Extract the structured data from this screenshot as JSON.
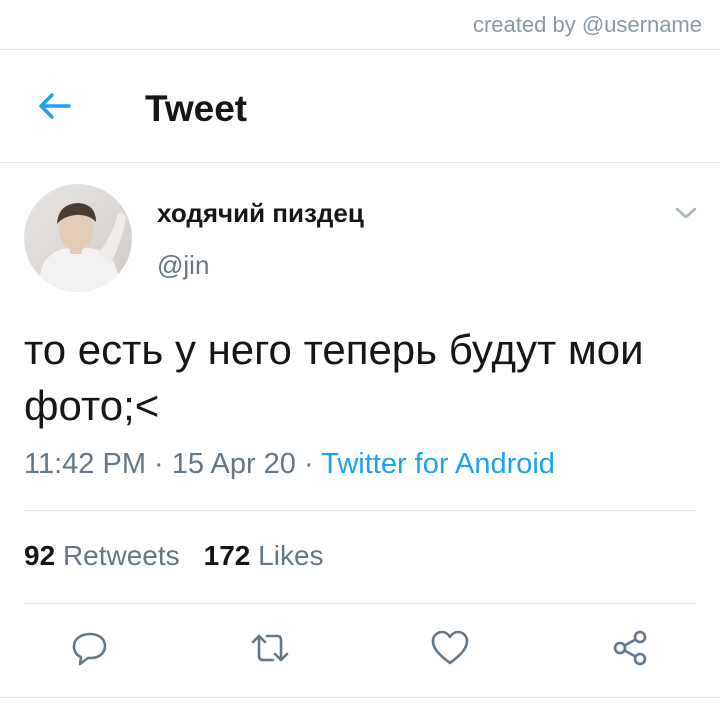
{
  "watermark": "created by @username",
  "header": {
    "title": "Tweet"
  },
  "tweet": {
    "display_name": "ходячий пиздец",
    "handle": "@jin",
    "text": "то есть у него теперь будут мои фото;<",
    "time": "11:42 PM",
    "date": "15 Apr 20",
    "separator": "·",
    "source": "Twitter for Android"
  },
  "stats": {
    "retweets_count": "92",
    "retweets_label": "Retweets",
    "likes_count": "172",
    "likes_label": "Likes"
  },
  "icons": {
    "back": "arrow-left-icon",
    "caret": "chevron-down-icon",
    "reply": "reply-icon",
    "retweet": "retweet-icon",
    "like": "heart-icon",
    "share": "share-icon"
  },
  "colors": {
    "accent": "#1da1f2",
    "text": "#14171a",
    "secondary": "#657786",
    "divider": "#e1e8ed"
  }
}
